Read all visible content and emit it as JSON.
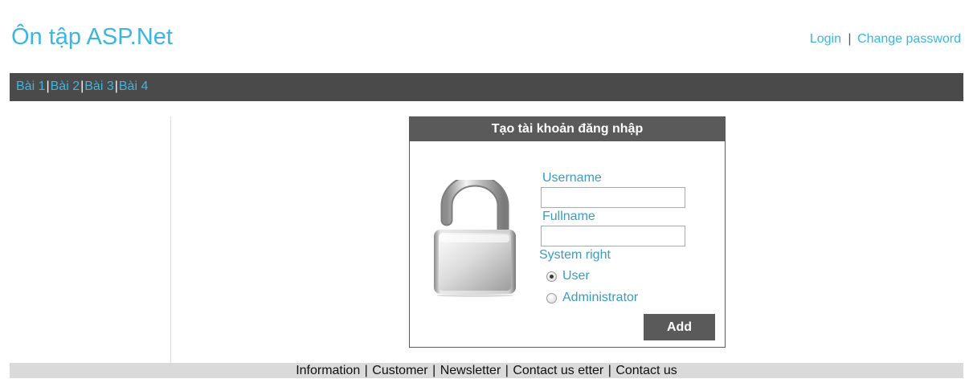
{
  "header": {
    "title": "Ôn tập ASP.Net",
    "links": [
      {
        "label": "Login"
      },
      {
        "label": "Change password"
      }
    ],
    "separator": "|"
  },
  "nav": {
    "items": [
      {
        "label": "Bài 1"
      },
      {
        "label": "Bài 2"
      },
      {
        "label": "Bài 3"
      },
      {
        "label": "Bài 4"
      }
    ],
    "separator": "|"
  },
  "form": {
    "title": "Tạo tài khoản đăng nhập",
    "username_label": "Username",
    "username_value": "",
    "fullname_label": "Fullname",
    "fullname_value": "",
    "system_right_label": "System right",
    "options": [
      {
        "label": "User",
        "checked": true
      },
      {
        "label": "Administrator",
        "checked": false
      }
    ],
    "add_label": "Add",
    "icon": "open-padlock-icon"
  },
  "footer": {
    "items": [
      {
        "label": "Information"
      },
      {
        "label": "Customer"
      },
      {
        "label": "Newsletter"
      },
      {
        "label": "Contact us etter"
      },
      {
        "label": "Contact us"
      }
    ],
    "separator": "|"
  },
  "colors": {
    "link": "#3cb6e0",
    "label": "#3a9cc0",
    "nav_bg": "#4a4a4a",
    "panel_header_bg": "#5a5a5a",
    "footer_bg": "#dadada"
  }
}
